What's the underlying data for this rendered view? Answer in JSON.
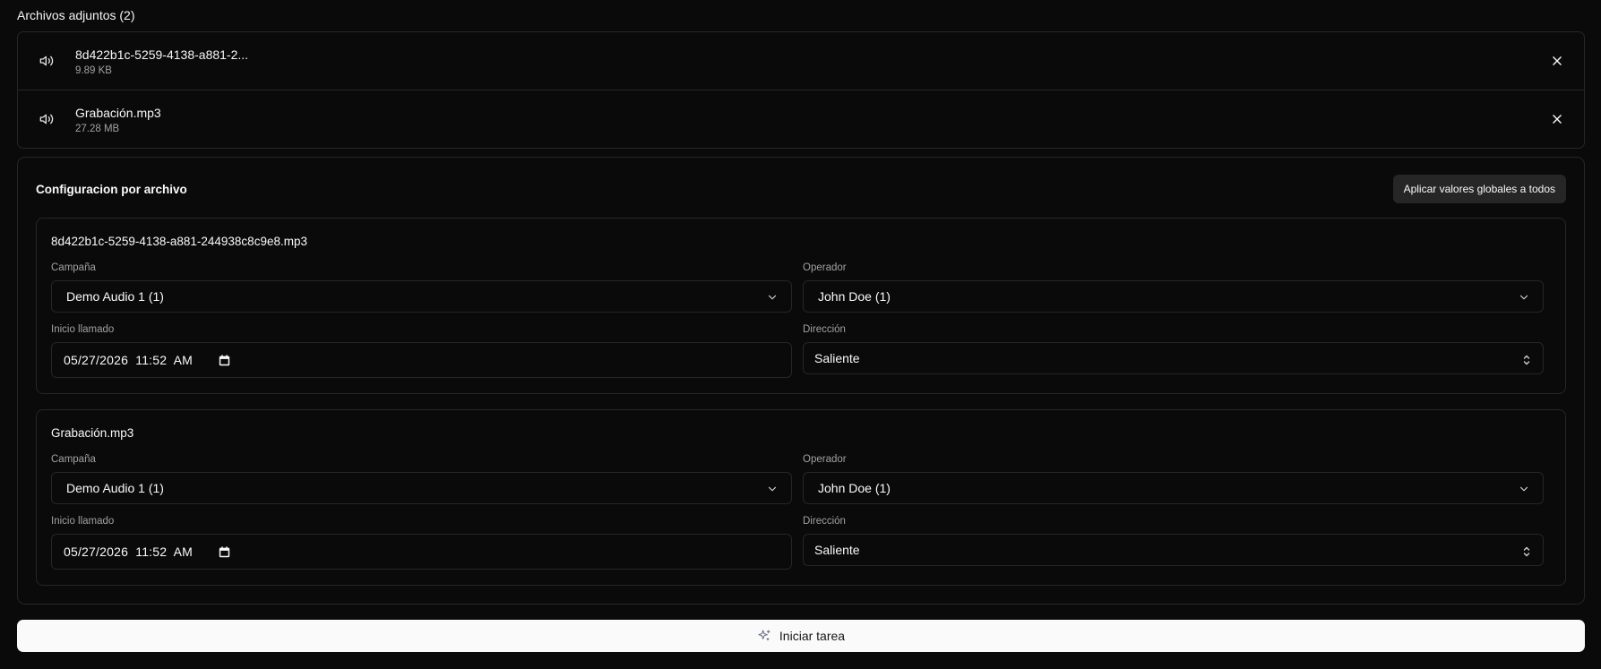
{
  "attachments": {
    "title": "Archivos adjuntos (2)",
    "items": [
      {
        "name": "8d422b1c-5259-4138-a881-2...",
        "size": "9.89 KB",
        "icon": "speaker-icon"
      },
      {
        "name": "Grabación.mp3",
        "size": "27.28 MB",
        "icon": "speaker-icon"
      }
    ]
  },
  "config": {
    "title": "Configuracion por archivo",
    "apply_label": "Aplicar valores globales a todos",
    "files": [
      {
        "name": "8d422b1c-5259-4138-a881-244938c8c9e8.mp3",
        "campaign_label": "Campaña",
        "campaign_value": "Demo Audio 1 (1)",
        "operator_label": "Operador",
        "operator_value": "John Doe (1)",
        "start_label": "Inicio llamado",
        "start_value": "05/27/2026  11:52  AM",
        "direction_label": "Dirección",
        "direction_value": "Saliente"
      },
      {
        "name": "Grabación.mp3",
        "campaign_label": "Campaña",
        "campaign_value": "Demo Audio 1 (1)",
        "operator_label": "Operador",
        "operator_value": "John Doe (1)",
        "start_label": "Inicio llamado",
        "start_value": "05/27/2026  11:52  AM",
        "direction_label": "Dirección",
        "direction_value": "Saliente"
      }
    ]
  },
  "start_button": {
    "label": "Iniciar tarea",
    "icon": "sparkles-icon"
  },
  "colors": {
    "background": "#0a0a0a",
    "border": "#262626",
    "muted_text": "#a1a1a1",
    "primary_button": "#fafafa"
  }
}
